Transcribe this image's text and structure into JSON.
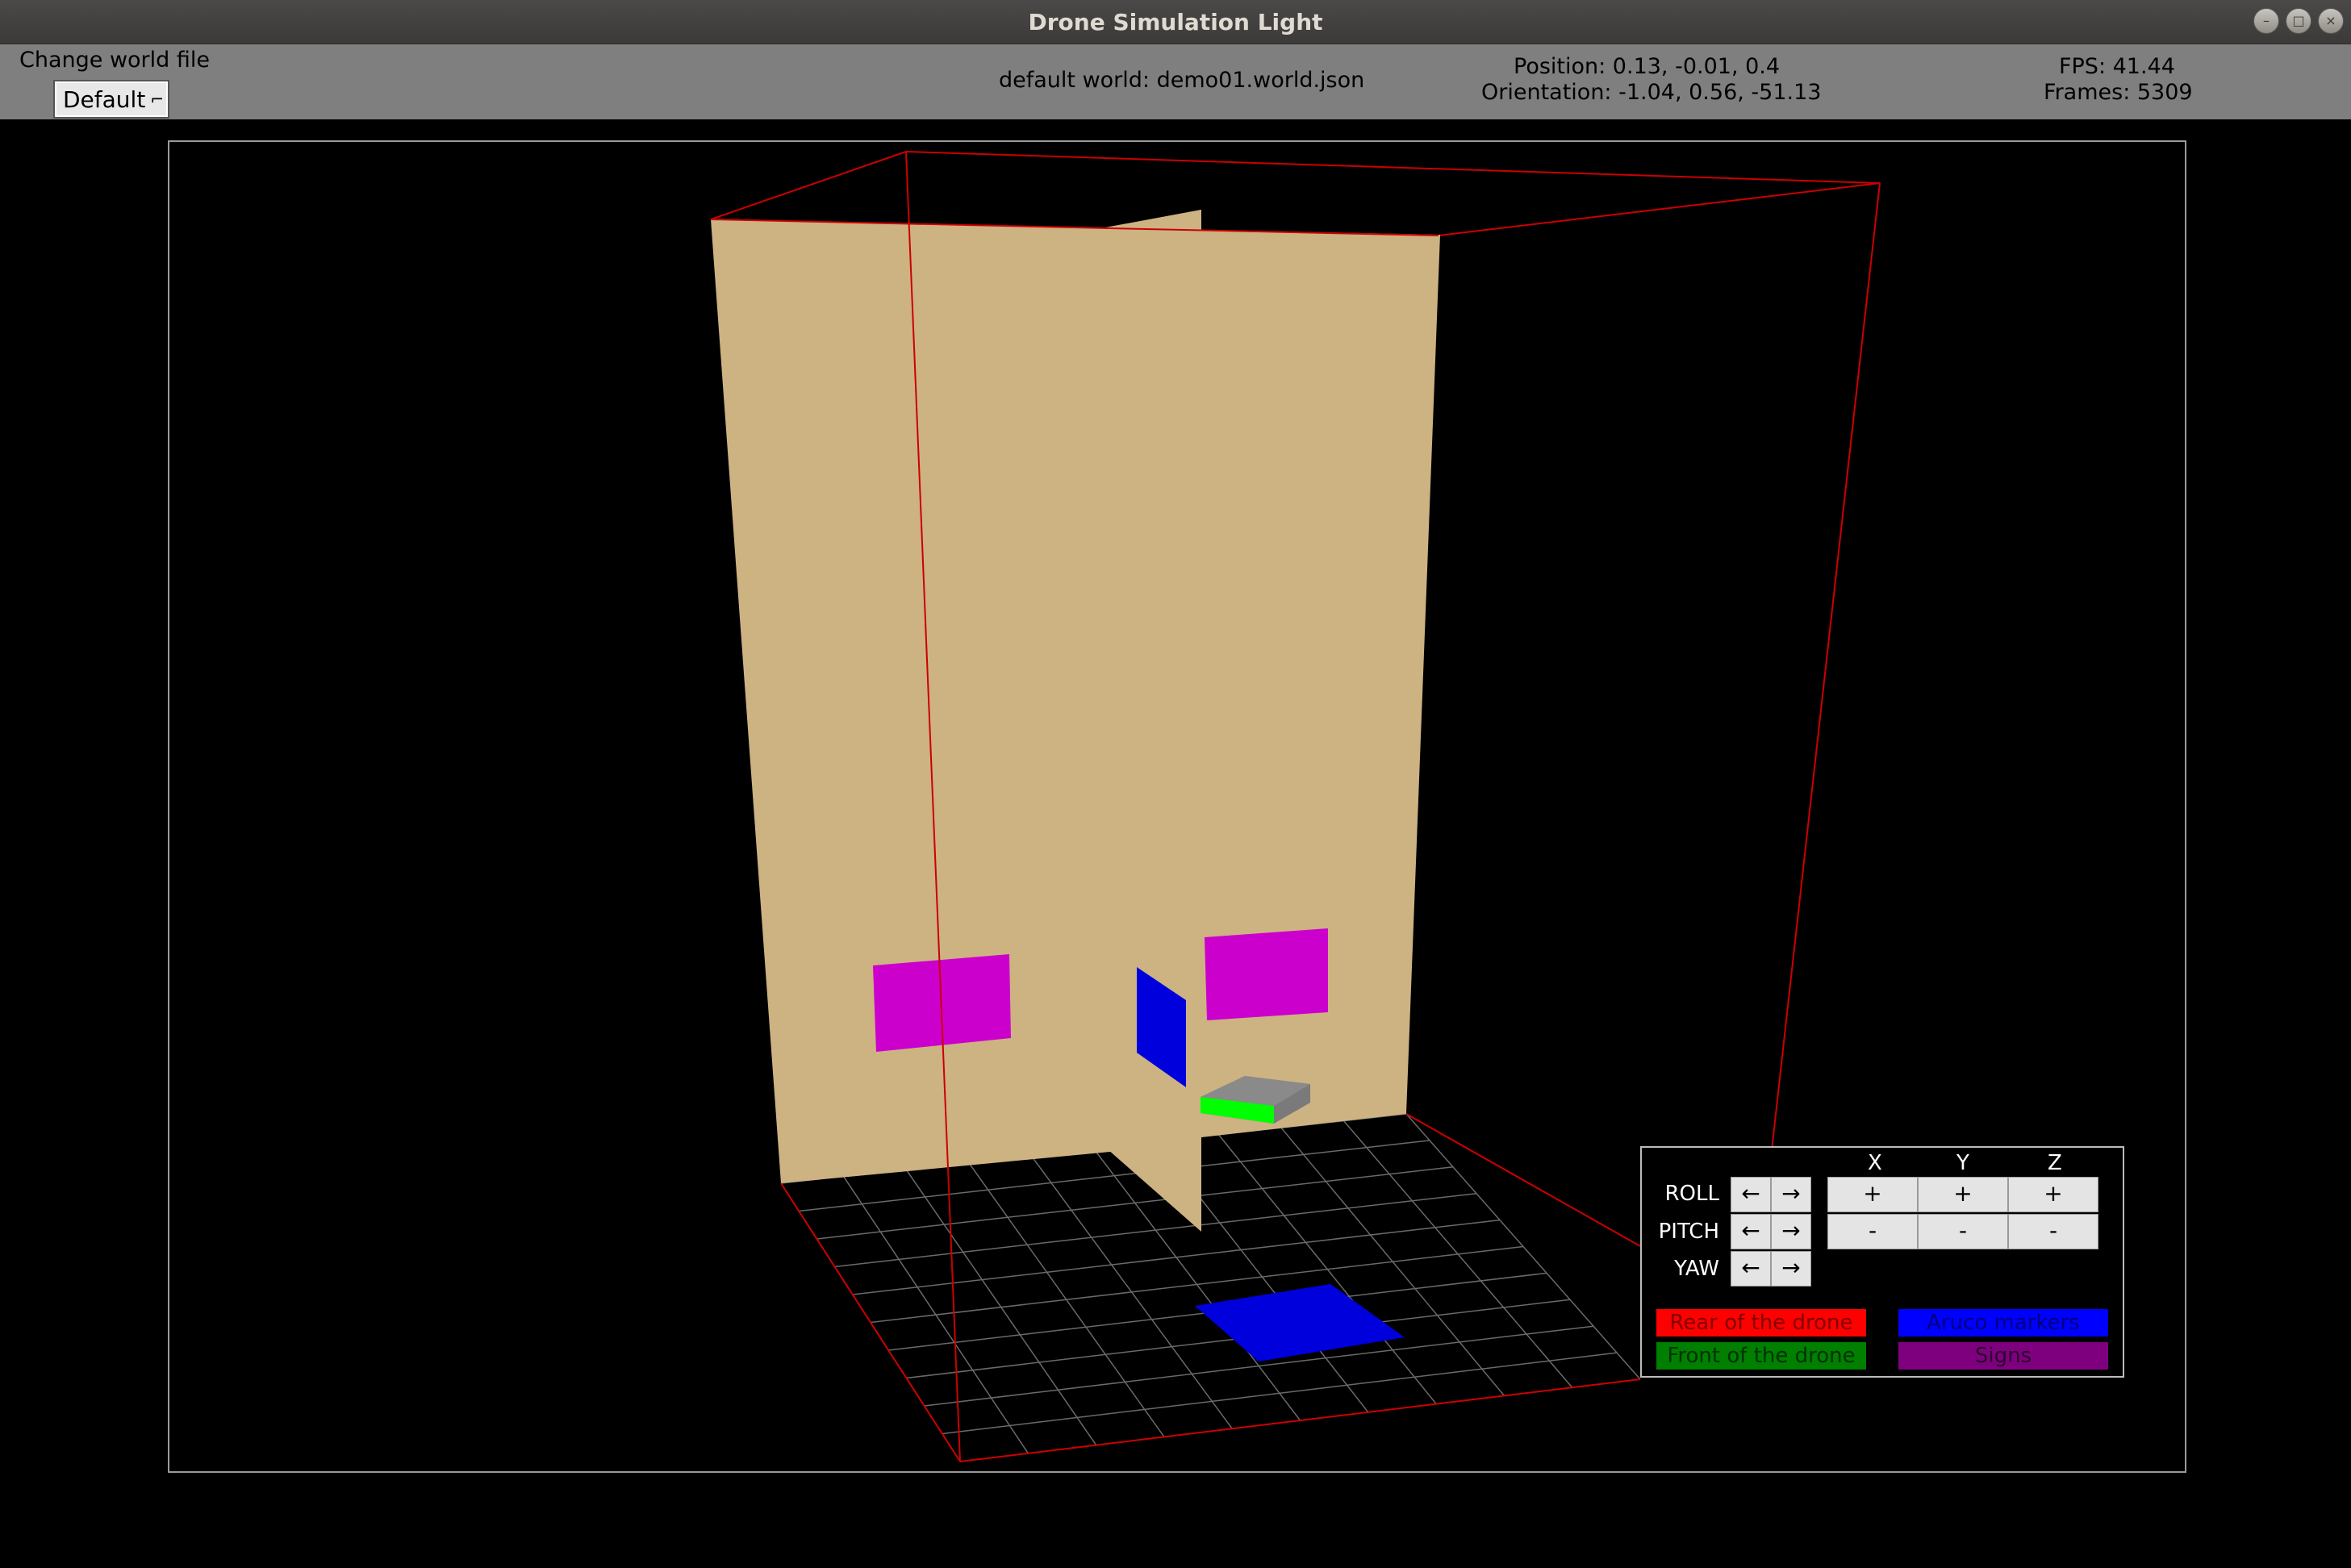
{
  "window": {
    "title": "Drone Simulation Light"
  },
  "toolbar": {
    "change_world_label": "Change world file",
    "world_select_value": "Default",
    "world_select_arrow": "⌐",
    "default_world": "default world: demo01.world.json",
    "position": "Position: 0.13, -0.01, 0.4",
    "orientation": "Orientation: -1.04, 0.56, -51.13",
    "fps": "FPS: 41.44",
    "frames": "Frames: 5309"
  },
  "controls": {
    "axes": [
      "X",
      "Y",
      "Z"
    ],
    "rows": [
      "ROLL",
      "PITCH",
      "YAW"
    ],
    "left_arrow": "←",
    "right_arrow": "→",
    "plus": "+",
    "minus": "-"
  },
  "legend": {
    "rear": {
      "label": "Rear of the drone",
      "color": "#ff0000"
    },
    "front": {
      "label": "Front of the drone",
      "color": "#007f00"
    },
    "aruco": {
      "label": "Aruco markers",
      "color": "#0000ff"
    },
    "signs": {
      "label": "Signs",
      "color": "#7f007f"
    }
  },
  "scene_colors": {
    "wall": "#cdb282",
    "sign": "#cc00cc",
    "marker": "#0000dd",
    "drone_body": "#8a8a8a",
    "drone_front": "#00ff00",
    "bounds": "#cc0000",
    "grid": "#6a6a6a"
  }
}
